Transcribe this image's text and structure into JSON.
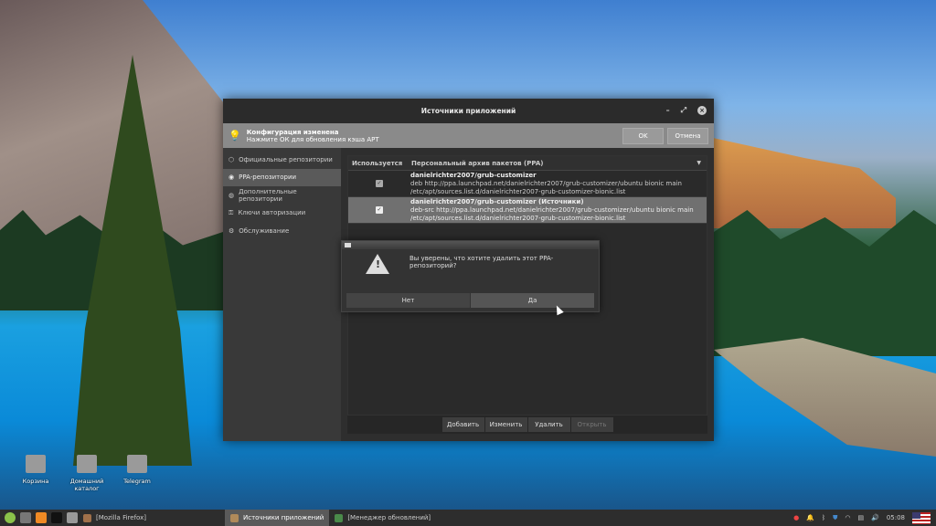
{
  "window": {
    "title": "Источники приложений"
  },
  "infobar": {
    "title": "Конфигурация изменена",
    "subtitle": "Нажмите ОК для обновления кэша APT",
    "ok": "OK",
    "cancel": "Отмена"
  },
  "sidebar": {
    "items": [
      {
        "label": "Официальные репозитории"
      },
      {
        "label": "PPA-репозитории",
        "selected": true
      },
      {
        "label": "Дополнительные репозитории"
      },
      {
        "label": "Ключи авторизации"
      },
      {
        "label": "Обслуживание"
      }
    ]
  },
  "table": {
    "col_used": "Используется",
    "col_ppa": "Персональный архив пакетов (PPA)",
    "rows": [
      {
        "checked": true,
        "name": "danielrichter2007/grub-customizer",
        "line": "deb http://ppa.launchpad.net/danielrichter2007/grub-customizer/ubuntu bionic main",
        "file": "/etc/apt/sources.list.d/danielrichter2007-grub-customizer-bionic.list"
      },
      {
        "checked": true,
        "name": "danielrichter2007/grub-customizer (Источники)",
        "line": "deb-src http://ppa.launchpad.net/danielrichter2007/grub-customizer/ubuntu bionic main",
        "file": "/etc/apt/sources.list.d/danielrichter2007-grub-customizer-bionic.list",
        "selected": true
      }
    ]
  },
  "toolbar": {
    "add": "Добавить",
    "edit": "Изменить",
    "remove": "Удалить",
    "open": "Открыть"
  },
  "dialog": {
    "message": "Вы уверены, что хотите удалить этот PPA-репозиторий?",
    "no": "Нет",
    "yes": "Да"
  },
  "desktop": {
    "icons": [
      {
        "label": "Корзина"
      },
      {
        "label": "Домашний каталог"
      },
      {
        "label": "Telegram"
      }
    ]
  },
  "taskbar": {
    "tasks": [
      {
        "label": "[Mozilla Firefox]"
      },
      {
        "label": "Источники приложений",
        "active": true
      },
      {
        "label": "[Менеджер обновлений]"
      }
    ],
    "clock": "05:08"
  }
}
